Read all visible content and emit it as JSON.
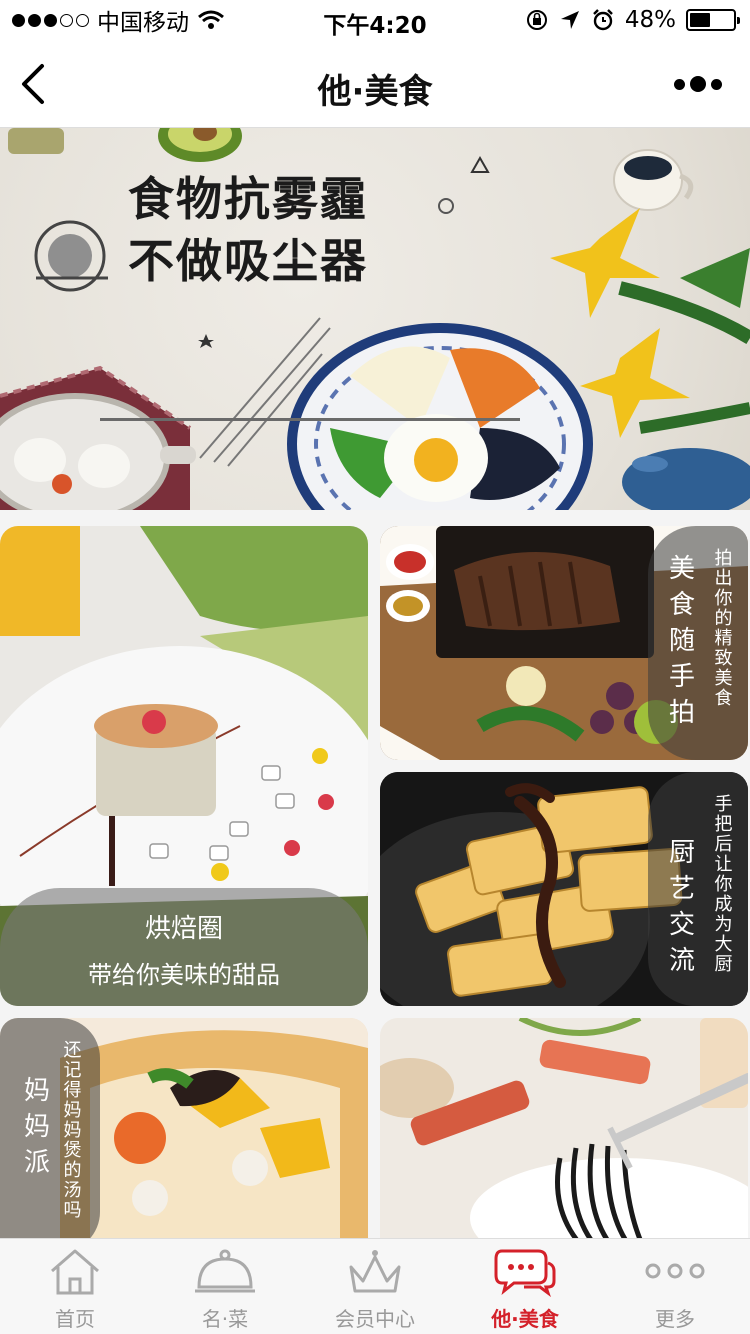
{
  "status_bar": {
    "carrier": "中国移动",
    "time": "下午4:20",
    "battery_text": "48%",
    "battery_level": 0.48
  },
  "nav": {
    "title": "他·美食"
  },
  "banner": {
    "headline_line1": "食物抗雾霾",
    "headline_line2": "不做吸尘器"
  },
  "cards": {
    "dessert": {
      "title": "烘焙圈",
      "subtitle": "带给你美味的甜品"
    },
    "steak": {
      "title": "美食随手拍",
      "subtitle": "拍出你的精致美食"
    },
    "cooking": {
      "title": "厨艺交流",
      "subtitle": "手把后让你成为大厨"
    },
    "pizza": {
      "title": "妈妈派",
      "subtitle": "还记得妈妈煲的汤吗"
    }
  },
  "tabs": [
    {
      "label": "首页",
      "icon": "home-icon",
      "active": false
    },
    {
      "label": "名·菜",
      "icon": "cloche-icon",
      "active": false
    },
    {
      "label": "会员中心",
      "icon": "crown-icon",
      "active": false
    },
    {
      "label": "他·美食",
      "icon": "chat-bubbles-icon",
      "active": true
    },
    {
      "label": "更多",
      "icon": "more-dots-icon",
      "active": false
    }
  ],
  "colors": {
    "accent": "#d4212a",
    "tab_inactive": "#999999"
  }
}
